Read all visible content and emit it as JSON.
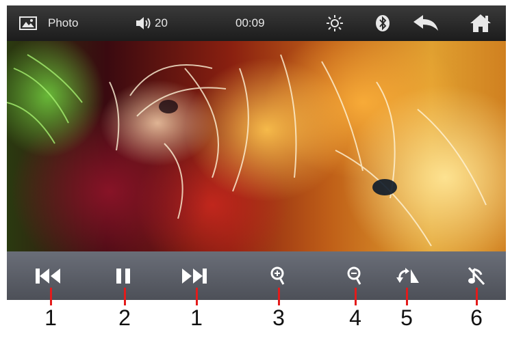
{
  "topbar": {
    "mode_label": "Photo",
    "volume_value": "20",
    "time": "00:09"
  },
  "controls": {
    "prev_icon": "skip-previous-icon",
    "pause_icon": "pause-icon",
    "next_icon": "skip-next-icon",
    "zoom_in_icon": "zoom-in-icon",
    "zoom_out_icon": "zoom-out-icon",
    "rotate_icon": "rotate-icon",
    "music_off_icon": "music-off-icon"
  },
  "callouts": [
    "1",
    "2",
    "1",
    "3",
    "4",
    "5",
    "6"
  ],
  "colors": {
    "topbar_bg": "#2a2a2a",
    "controlbar_bg": "#5a5e66",
    "icon_color": "#ffffff",
    "callout_line": "#e31b1b"
  }
}
